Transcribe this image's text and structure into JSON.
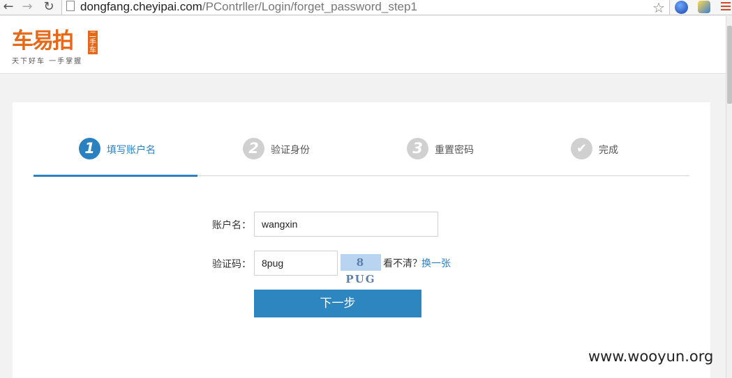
{
  "browser": {
    "back_icon": "←",
    "forward_icon": "→",
    "reload_icon": "↻",
    "url_host": "dongfang.cheyipai.com",
    "url_path": "/PContrller/Login/forget_password_step1",
    "star_icon": "☆"
  },
  "header": {
    "logo_text": "车易拍",
    "logo_badge": "二手车",
    "logo_slogan": "天下好车  一手掌握",
    "brand_color": "#e4691a"
  },
  "steps": [
    {
      "number": "1",
      "label": "填写账户名",
      "active": true
    },
    {
      "number": "2",
      "label": "验证身份",
      "active": false
    },
    {
      "number": "3",
      "label": "重置密码",
      "active": false
    },
    {
      "number": "✔",
      "label": "完成",
      "active": false
    }
  ],
  "form": {
    "account_label": "账户名：",
    "account_value": "wangxin",
    "captcha_label": "验证码：",
    "captcha_value": "8pug",
    "captcha_image_text": "8 PUG",
    "hint_text": "看不清？",
    "refresh_link": "换一张",
    "submit_label": "下一步"
  },
  "colors": {
    "accent": "#2b80c0",
    "button": "#2e86c1"
  },
  "watermark": "www.wooyun.org"
}
